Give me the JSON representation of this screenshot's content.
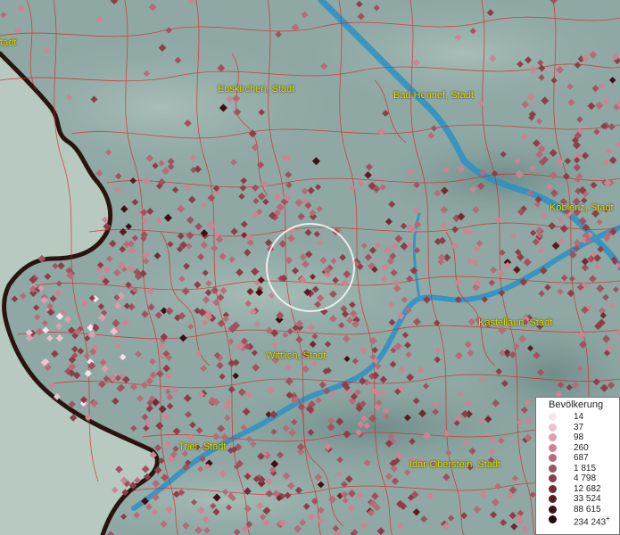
{
  "map": {
    "colors": {
      "land": "#8fa8a4",
      "neighbor_country": "#b8c9c0",
      "border": "#2a1410",
      "river": "#2a92c6",
      "district_lines": "#e01c1c",
      "label": "#e2e000"
    },
    "cities": [
      {
        "id": "cut-off-left",
        "name": "tadt"
      },
      {
        "id": "euskirchen",
        "name": "Euskirchen, Stadt"
      },
      {
        "id": "bad-honnef",
        "name": "Bad Honnef, Stadt"
      },
      {
        "id": "koblenz",
        "name": "Koblenz, Stadt"
      },
      {
        "id": "kastellaun",
        "name": "Kastellaun, Stadt"
      },
      {
        "id": "wittlich",
        "name": "Wittlich, Stadt"
      },
      {
        "id": "trier",
        "name": "Trier, Stadt"
      },
      {
        "id": "idar-oberstein",
        "name": "Idar-Oberstein, Stadt"
      }
    ]
  },
  "legend": {
    "title": "Bevölkerung",
    "entries": [
      {
        "label": "14",
        "color": "#f7e4ec"
      },
      {
        "label": "37",
        "color": "#ecc3cf"
      },
      {
        "label": "98",
        "color": "#dba0ae"
      },
      {
        "label": "260",
        "color": "#c98592"
      },
      {
        "label": "687",
        "color": "#b66c78"
      },
      {
        "label": "1 815",
        "color": "#a05260"
      },
      {
        "label": "4 798",
        "color": "#8c3f4a"
      },
      {
        "label": "12 682",
        "color": "#742a34"
      },
      {
        "label": "33 524",
        "color": "#5c1a22"
      },
      {
        "label": "88 615",
        "color": "#420d14"
      },
      {
        "label": "234 243",
        "color": "#250508",
        "plus": "+"
      }
    ]
  }
}
